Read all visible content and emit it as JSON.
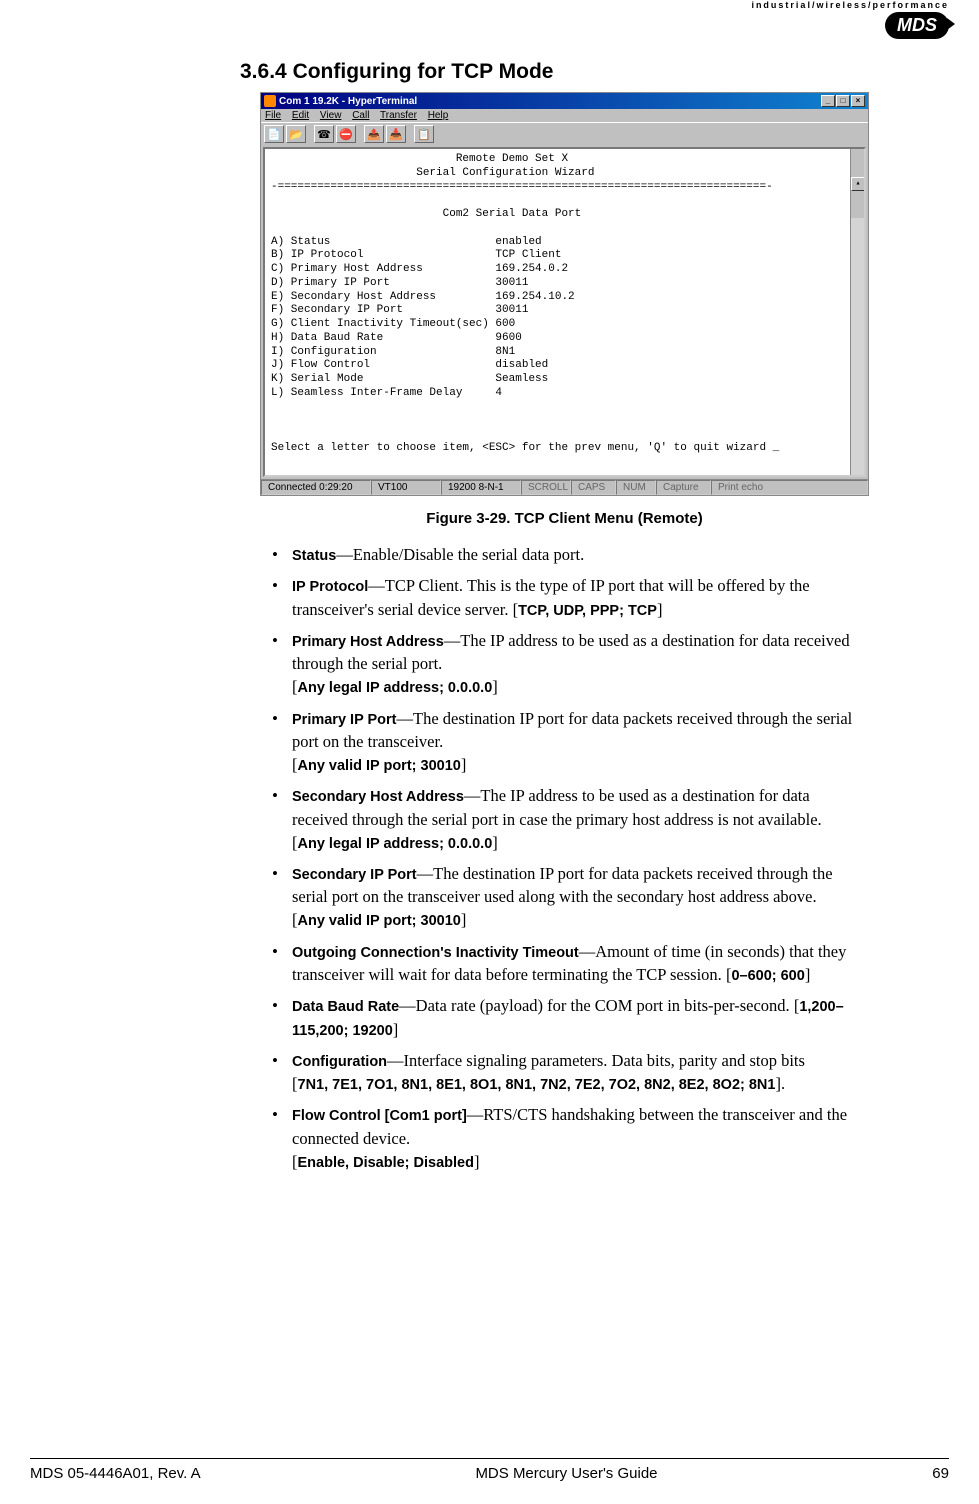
{
  "header": {
    "tagline": "industrial/wireless/performance",
    "logo": "MDS"
  },
  "section": {
    "number": "3.6.4",
    "title": "Configuring for TCP Mode"
  },
  "terminal": {
    "title": "Com 1 19.2K - HyperTerminal",
    "menus": [
      "File",
      "Edit",
      "View",
      "Call",
      "Transfer",
      "Help"
    ],
    "body_header": "                            Remote Demo Set X\n                      Serial Configuration Wizard",
    "body_sep": "-==========================================================================-",
    "body_subheader": "                          Com2 Serial Data Port",
    "rows": [
      {
        "k": "A) Status",
        "v": "enabled"
      },
      {
        "k": "B) IP Protocol",
        "v": "TCP Client"
      },
      {
        "k": "C) Primary Host Address",
        "v": "169.254.0.2"
      },
      {
        "k": "D) Primary IP Port",
        "v": "30011"
      },
      {
        "k": "E) Secondary Host Address",
        "v": "169.254.10.2"
      },
      {
        "k": "F) Secondary IP Port",
        "v": "30011"
      },
      {
        "k": "G) Client Inactivity Timeout(sec)",
        "v": "600"
      },
      {
        "k": "H) Data Baud Rate",
        "v": "9600"
      },
      {
        "k": "I) Configuration",
        "v": "8N1"
      },
      {
        "k": "J) Flow Control",
        "v": "disabled"
      },
      {
        "k": "K) Serial Mode",
        "v": "Seamless"
      },
      {
        "k": "L) Seamless Inter-Frame Delay",
        "v": "4"
      }
    ],
    "prompt": "Select a letter to choose item, <ESC> for the prev menu, 'Q' to quit wizard _",
    "status": {
      "connected": "Connected 0:29:20",
      "emu": "VT100",
      "speed": "19200 8-N-1",
      "scroll": "SCROLL",
      "caps": "CAPS",
      "num": "NUM",
      "capture": "Capture",
      "echo": "Print echo"
    }
  },
  "figure": {
    "caption": "Figure 3-29. TCP Client Menu (Remote)"
  },
  "bullets": [
    {
      "label": "Status",
      "desc": "Enable/Disable the serial data port.",
      "range": ""
    },
    {
      "label": "IP Protocol",
      "desc": "TCP Client. This is the type of IP port that will be offered by the transceiver's serial device server.",
      "range": "TCP, UDP, PPP; TCP"
    },
    {
      "label": "Primary Host Address",
      "desc": "The IP address to be used as a destination for data received through the serial port.",
      "range": "Any legal IP address; 0.0.0.0"
    },
    {
      "label": "Primary IP Port",
      "desc": "The destination IP port for data packets received through the serial port on the transceiver.",
      "range": "Any valid IP port; 30010"
    },
    {
      "label": "Secondary Host Address",
      "desc": "The IP address to be used as a destination for data received through the serial port in case the primary host address is not available.",
      "range": "Any legal IP address; 0.0.0.0"
    },
    {
      "label": "Secondary IP Port",
      "desc": "The destination IP port for data packets received through the serial port on the transceiver used along with the secondary host address above.",
      "range": "Any valid IP port; 30010"
    },
    {
      "label": "Outgoing Connection's Inactivity Timeout",
      "desc": "Amount of time (in seconds) that they transceiver will wait for data before terminating the TCP session.",
      "range": "0–600; 600"
    },
    {
      "label": "Data Baud Rate",
      "desc": "Data rate (payload) for the COM port in bits-per-second.",
      "range": "1,200–115,200; 19200"
    },
    {
      "label": "Configuration",
      "desc": "Interface signaling parameters. Data bits, parity and stop bits",
      "range": "7N1, 7E1, 7O1, 8N1, 8E1, 8O1, 8N1, 7N2, 7E2, 7O2, 8N2, 8E2, 8O2; 8N1",
      "suffix": "."
    },
    {
      "label": "Flow Control [Com1 port]",
      "desc": "RTS/CTS handshaking between the transceiver and the connected device.",
      "range": "Enable, Disable; Disabled"
    }
  ],
  "footer": {
    "left": "MDS 05-4446A01, Rev. A",
    "center": "MDS Mercury User's Guide",
    "right": "69"
  }
}
